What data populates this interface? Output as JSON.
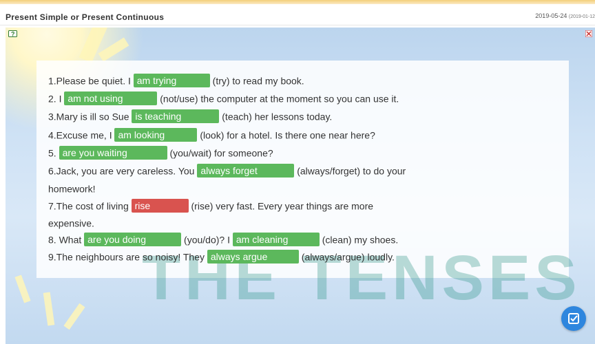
{
  "header": {
    "title": "Present Simple or Present Continuous",
    "date": "2019-05-24",
    "date_sub": "(2019-01-12"
  },
  "colors": {
    "correct": "#5cb85c",
    "wrong": "#d9534f",
    "accent": "#2e86de"
  },
  "watermark": "THE TENSES",
  "q1": {
    "pre": "1.Please be quiet. I",
    "ans": "am trying",
    "post": "(try) to read my book."
  },
  "q2": {
    "pre": "2. I",
    "ans": "am not using",
    "post": "(not/use) the computer at the moment so you can use it."
  },
  "q3": {
    "pre": "3.Mary is ill so Sue",
    "ans": "is teaching",
    "post": "(teach) her lessons today."
  },
  "q4": {
    "pre": "4.Excuse me, I",
    "ans": "am looking",
    "post": "(look) for a hotel. Is there one near here?"
  },
  "q5": {
    "pre": "5.",
    "ans": "are you waiting",
    "post": "(you/wait) for someone?"
  },
  "q6": {
    "pre": "6.Jack, you are very careless. You",
    "ans": "always forget",
    "post": "(always/forget) to do your",
    "cont": "homework!"
  },
  "q7": {
    "pre": "7.The cost of living",
    "ans": "rise",
    "post": "(rise) very fast. Every year things are more",
    "cont": "expensive."
  },
  "q8": {
    "pre": "8. What",
    "ans1": "are you doing",
    "mid": "(you/do)? I",
    "ans2": "am cleaning",
    "post": "(clean) my shoes."
  },
  "q9": {
    "pre": "9.The neighbours are so noisy! They",
    "ans": "always argue",
    "post": "(always/argue) loudly."
  },
  "icons": {
    "help": "help-icon",
    "close": "close-icon",
    "submit": "edit-check-icon"
  }
}
